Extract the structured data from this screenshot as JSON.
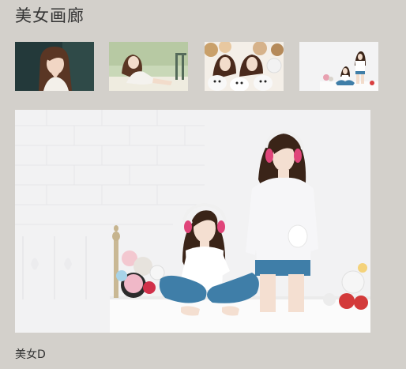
{
  "gallery": {
    "title": "美女画廊",
    "thumbnails": [
      {
        "id": "a"
      },
      {
        "id": "b"
      },
      {
        "id": "c"
      },
      {
        "id": "d"
      }
    ],
    "selected": {
      "caption": "美女D"
    }
  },
  "colors": {
    "page_background": "#d3d0cb",
    "text": "#333333",
    "photo_wall": "#f2f2f2",
    "denim": "#3f7ea8",
    "hair": "#3a2418",
    "headphone_pink": "#e0457a"
  }
}
